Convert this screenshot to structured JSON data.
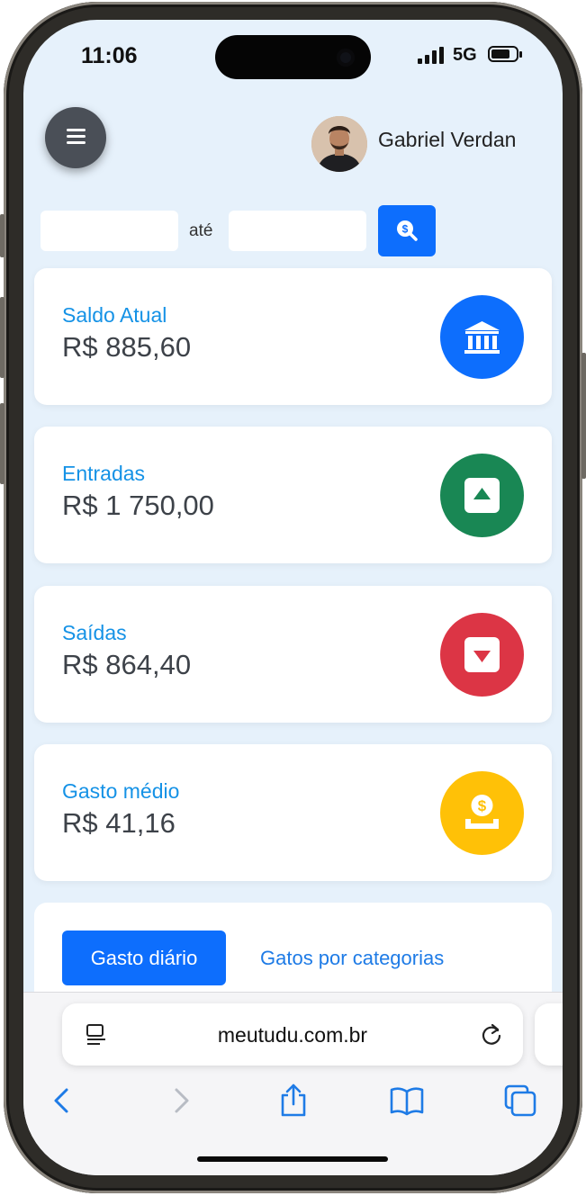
{
  "status_bar": {
    "time": "11:06",
    "network": "5G"
  },
  "header": {
    "user_name": "Gabriel Verdan"
  },
  "filter": {
    "separator": "até",
    "start_value": "",
    "end_value": ""
  },
  "cards": [
    {
      "label": "Saldo Atual",
      "value": "R$ 885,60",
      "icon": "bank-icon",
      "color": "#0d6efd"
    },
    {
      "label": "Entradas",
      "value": "R$ 1 750,00",
      "icon": "caret-up-square-icon",
      "color": "#198754"
    },
    {
      "label": "Saídas",
      "value": "R$ 864,40",
      "icon": "caret-down-square-icon",
      "color": "#dc3545"
    },
    {
      "label": "Gasto médio",
      "value": "R$ 41,16",
      "icon": "cash-coin-icon",
      "color": "#ffc107"
    }
  ],
  "tabs": {
    "active": "Gasto diário",
    "other": "Gatos por categorias"
  },
  "browser": {
    "url": "meutudu.com.br"
  },
  "colors": {
    "primary": "#0d6efd",
    "label_blue": "#1592e6",
    "background": "#e6f1fb"
  }
}
